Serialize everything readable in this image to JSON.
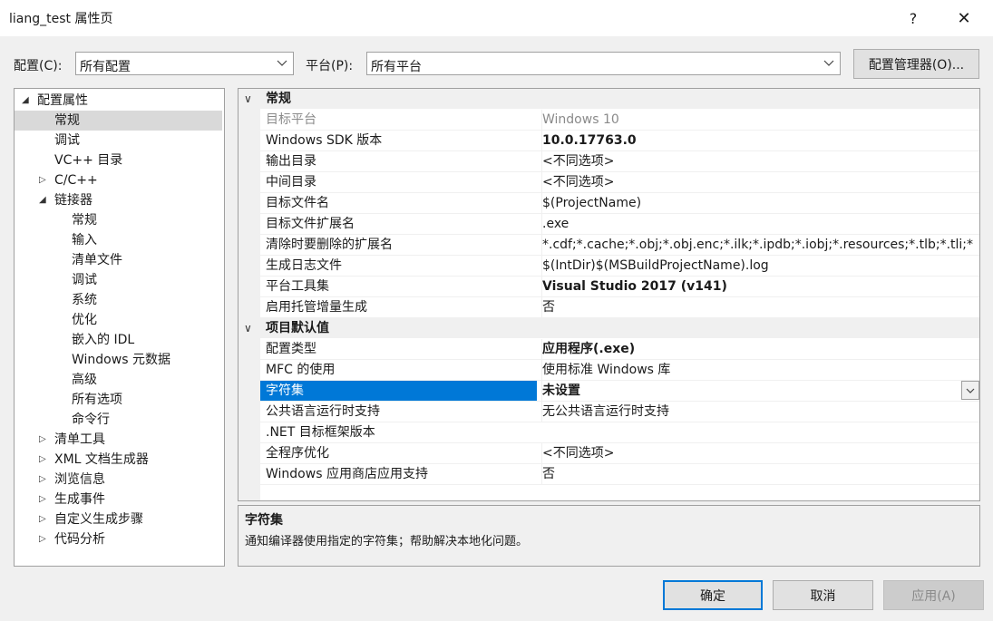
{
  "window": {
    "title": "liang_test 属性页",
    "help": "?",
    "close": "✕"
  },
  "toolbar": {
    "config_label": "配置(C):",
    "config_value": "所有配置",
    "platform_label": "平台(P):",
    "platform_value": "所有平台",
    "config_manager": "配置管理器(O)..."
  },
  "tree": {
    "items": [
      {
        "label": "配置属性",
        "exp": "◢",
        "level": 0
      },
      {
        "label": "常规",
        "exp": "",
        "level": 1,
        "selected": true
      },
      {
        "label": "调试",
        "exp": "",
        "level": 1
      },
      {
        "label": "VC++ 目录",
        "exp": "",
        "level": 1
      },
      {
        "label": "C/C++",
        "exp": "▷",
        "level": 1
      },
      {
        "label": "链接器",
        "exp": "◢",
        "level": 1
      },
      {
        "label": "常规",
        "exp": "",
        "level": 2
      },
      {
        "label": "输入",
        "exp": "",
        "level": 2
      },
      {
        "label": "清单文件",
        "exp": "",
        "level": 2
      },
      {
        "label": "调试",
        "exp": "",
        "level": 2
      },
      {
        "label": "系统",
        "exp": "",
        "level": 2
      },
      {
        "label": "优化",
        "exp": "",
        "level": 2
      },
      {
        "label": "嵌入的 IDL",
        "exp": "",
        "level": 2
      },
      {
        "label": "Windows 元数据",
        "exp": "",
        "level": 2
      },
      {
        "label": "高级",
        "exp": "",
        "level": 2
      },
      {
        "label": "所有选项",
        "exp": "",
        "level": 2
      },
      {
        "label": "命令行",
        "exp": "",
        "level": 2
      },
      {
        "label": "清单工具",
        "exp": "▷",
        "level": 1
      },
      {
        "label": "XML 文档生成器",
        "exp": "▷",
        "level": 1
      },
      {
        "label": "浏览信息",
        "exp": "▷",
        "level": 1
      },
      {
        "label": "生成事件",
        "exp": "▷",
        "level": 1
      },
      {
        "label": "自定义生成步骤",
        "exp": "▷",
        "level": 1
      },
      {
        "label": "代码分析",
        "exp": "▷",
        "level": 1
      }
    ]
  },
  "grid": {
    "chevron": "∨",
    "categories": [
      {
        "name": "常规",
        "rows": [
          {
            "name": "目标平台",
            "value": "Windows 10",
            "style": "gray"
          },
          {
            "name": "Windows SDK 版本",
            "value": "10.0.17763.0",
            "style": "bold"
          },
          {
            "name": "输出目录",
            "value": "<不同选项>",
            "style": ""
          },
          {
            "name": "中间目录",
            "value": "<不同选项>",
            "style": ""
          },
          {
            "name": "目标文件名",
            "value": "$(ProjectName)",
            "style": ""
          },
          {
            "name": "目标文件扩展名",
            "value": ".exe",
            "style": ""
          },
          {
            "name": "清除时要删除的扩展名",
            "value": "*.cdf;*.cache;*.obj;*.obj.enc;*.ilk;*.ipdb;*.iobj;*.resources;*.tlb;*.tli;*",
            "style": ""
          },
          {
            "name": "生成日志文件",
            "value": "$(IntDir)$(MSBuildProjectName).log",
            "style": ""
          },
          {
            "name": "平台工具集",
            "value": "Visual Studio 2017 (v141)",
            "style": "bold"
          },
          {
            "name": "启用托管增量生成",
            "value": "否",
            "style": ""
          }
        ]
      },
      {
        "name": "项目默认值",
        "rows": [
          {
            "name": "配置类型",
            "value": "应用程序(.exe)",
            "style": "bold"
          },
          {
            "name": "MFC 的使用",
            "value": "使用标准 Windows 库",
            "style": ""
          },
          {
            "name": "字符集",
            "value": "未设置",
            "style": "bold",
            "selected": true
          },
          {
            "name": "公共语言运行时支持",
            "value": "无公共语言运行时支持",
            "style": ""
          },
          {
            "name": ".NET 目标框架版本",
            "value": "",
            "style": ""
          },
          {
            "name": "全程序优化",
            "value": "<不同选项>",
            "style": ""
          },
          {
            "name": "Windows 应用商店应用支持",
            "value": "否",
            "style": ""
          }
        ]
      }
    ]
  },
  "description": {
    "title": "字符集",
    "text": "通知编译器使用指定的字符集；帮助解决本地化问题。"
  },
  "buttons": {
    "ok": "确定",
    "cancel": "取消",
    "apply": "应用(A)"
  }
}
